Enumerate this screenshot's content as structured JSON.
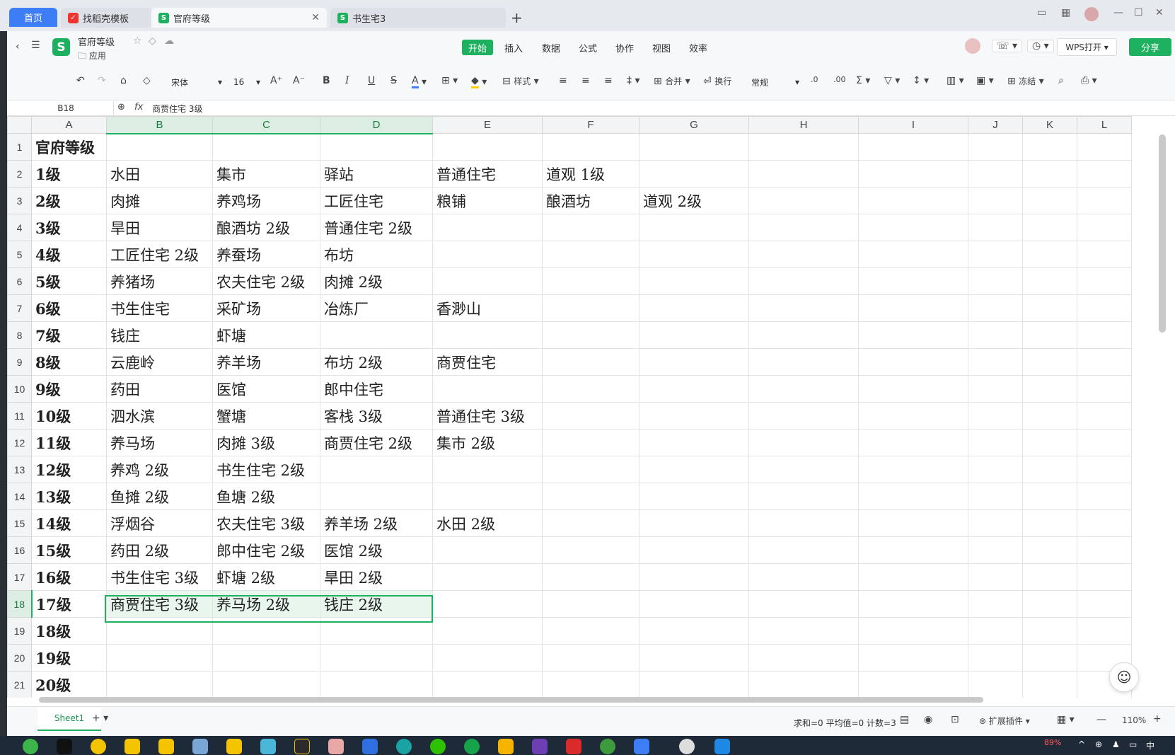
{
  "tabs": {
    "home": "首页",
    "items": [
      {
        "label": "找稻壳模板"
      },
      {
        "label": "官府等级"
      },
      {
        "label": "书生宅3"
      }
    ]
  },
  "doc": {
    "name": "官府等级",
    "folder": "应用"
  },
  "menu": [
    "开始",
    "插入",
    "数据",
    "公式",
    "协作",
    "视图",
    "效率"
  ],
  "header_buttons": {
    "wps_open": "WPS打开",
    "share": "分享"
  },
  "toolbar": {
    "font": "宋体",
    "size": "16",
    "style": "样式",
    "merge": "合并",
    "wrap": "换行",
    "format": "常规",
    "freeze": "冻结"
  },
  "formula": {
    "cell": "B18",
    "content": "商贾住宅 3级"
  },
  "columns": [
    "A",
    "B",
    "C",
    "D",
    "E",
    "F",
    "G",
    "H",
    "I",
    "J",
    "K",
    "L"
  ],
  "rows": [
    {
      "n": "1",
      "cells": [
        "官府等级",
        "",
        "",
        "",
        "",
        "",
        ""
      ]
    },
    {
      "n": "2",
      "cells": [
        "1级",
        "水田",
        "集市",
        "驿站",
        "普通住宅",
        "道观 1级",
        ""
      ]
    },
    {
      "n": "3",
      "cells": [
        "2级",
        "肉摊",
        "养鸡场",
        "工匠住宅",
        "粮铺",
        "酿酒坊",
        "道观 2级"
      ]
    },
    {
      "n": "4",
      "cells": [
        "3级",
        "旱田",
        "酿酒坊 2级",
        "普通住宅 2级",
        "",
        "",
        ""
      ]
    },
    {
      "n": "5",
      "cells": [
        "4级",
        "工匠住宅 2级",
        "养蚕场",
        "布坊",
        "",
        "",
        ""
      ]
    },
    {
      "n": "6",
      "cells": [
        "5级",
        "养猪场",
        "农夫住宅 2级",
        "肉摊 2级",
        "",
        "",
        ""
      ]
    },
    {
      "n": "7",
      "cells": [
        "6级",
        "书生住宅",
        "采矿场",
        "冶炼厂",
        "香渺山",
        "",
        ""
      ]
    },
    {
      "n": "8",
      "cells": [
        "7级",
        "钱庄",
        "虾塘",
        "",
        "",
        "",
        ""
      ]
    },
    {
      "n": "9",
      "cells": [
        "8级",
        "云鹿岭",
        "养羊场",
        "布坊 2级",
        "商贾住宅",
        "",
        ""
      ]
    },
    {
      "n": "10",
      "cells": [
        "9级",
        "药田",
        "医馆",
        "郎中住宅",
        "",
        "",
        ""
      ]
    },
    {
      "n": "11",
      "cells": [
        "10级",
        "泗水滨",
        "蟹塘",
        "客栈 3级",
        "普通住宅 3级",
        "",
        ""
      ]
    },
    {
      "n": "12",
      "cells": [
        "11级",
        "养马场",
        "肉摊 3级",
        "商贾住宅 2级",
        "集市 2级",
        "",
        ""
      ]
    },
    {
      "n": "13",
      "cells": [
        "12级",
        "养鸡 2级",
        "书生住宅 2级",
        "",
        "",
        "",
        ""
      ]
    },
    {
      "n": "14",
      "cells": [
        "13级",
        "鱼摊 2级",
        "鱼塘 2级",
        "",
        "",
        "",
        ""
      ]
    },
    {
      "n": "15",
      "cells": [
        "14级",
        "浮烟谷",
        "农夫住宅 3级",
        "养羊场 2级",
        "水田 2级",
        "",
        ""
      ]
    },
    {
      "n": "16",
      "cells": [
        "15级",
        "药田 2级",
        "郎中住宅 2级",
        "医馆 2级",
        "",
        "",
        ""
      ]
    },
    {
      "n": "17",
      "cells": [
        "16级",
        "书生住宅 3级",
        "虾塘 2级",
        "旱田 2级",
        "",
        "",
        ""
      ]
    },
    {
      "n": "18",
      "cells": [
        "17级",
        "商贾住宅 3级",
        "养马场 2级",
        "钱庄 2级",
        "",
        "",
        ""
      ]
    },
    {
      "n": "19",
      "cells": [
        "18级",
        "",
        "",
        "",
        "",
        "",
        ""
      ]
    },
    {
      "n": "20",
      "cells": [
        "19级",
        "",
        "",
        "",
        "",
        "",
        ""
      ]
    },
    {
      "n": "21",
      "cells": [
        "20级",
        "",
        "",
        "",
        "",
        "",
        ""
      ]
    }
  ],
  "status": {
    "sheet_tab": "Sheet1",
    "summary": "求和=0 平均值=0 计数=3",
    "plugins": "扩展插件",
    "zoom": "110%"
  },
  "tray": {
    "battery": "89%",
    "ime": "中"
  },
  "colors": {
    "accent": "#1db15f",
    "home_tab": "#3d7ef6"
  }
}
